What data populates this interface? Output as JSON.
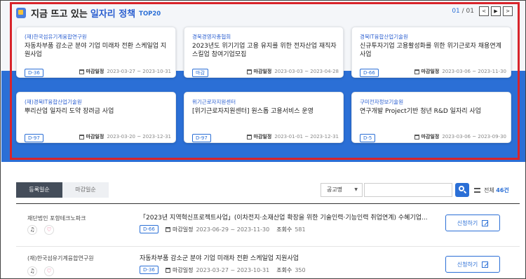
{
  "header": {
    "title_prefix": "지금 뜨고 있는",
    "title_main": "일자리 정책",
    "title_tag": "TOP20"
  },
  "pager": {
    "current": "01",
    "total": "/ 01",
    "prev": "<",
    "play": "▶",
    "next": ">"
  },
  "cards": [
    {
      "org": "(재)한국섬유기계융합연구원",
      "title": "자동차부품 감소군 분야 기업 미래차 전환 스케일업 지원사업",
      "badge": "D-36",
      "deadline_label": "마감일정",
      "period": "2023-03-27 ~ 2023-10-31"
    },
    {
      "org": "경북경영자총협회",
      "title": "2023년도 위기기업 고용 유지를 위한 전자산업 재직자 스킬업 참여기업모집",
      "badge": "마감",
      "deadline_label": "마감일정",
      "period": "2023-03-03 ~ 2023-04-28"
    },
    {
      "org": "경북IT융합산업기술원",
      "title": "신규투자기업 고용활성화를 위한 위기근로자 채용연계 사업",
      "badge": "D-66",
      "deadline_label": "마감일정",
      "period": "2023-03-06 ~ 2023-11-30"
    },
    {
      "org": "(재)경북IT융합산업기술원",
      "title": "뿌리산업 일자리 도약 장려금 사업",
      "badge": "D-97",
      "deadline_label": "마감일정",
      "period": "2023-03-20 ~ 2023-12-31"
    },
    {
      "org": "위기근로자지원센터",
      "title": "[위기근로자지원센터] 원스톱 고용서비스 운영",
      "badge": "D-97",
      "deadline_label": "마감일정",
      "period": "2023-01-01 ~ 2023-12-31"
    },
    {
      "org": "구미전자정보기술원",
      "title": "연구개발 Project기반 청년 R&D 일자리 사업",
      "badge": "D-5",
      "deadline_label": "마감일정",
      "period": "2023-03-06 ~ 2023-09-30"
    }
  ],
  "tabs": [
    {
      "label": "등록일순"
    },
    {
      "label": "마감일순"
    }
  ],
  "search": {
    "select_value": "공고명",
    "placeholder": ""
  },
  "total": {
    "label": "전체",
    "count": "46건"
  },
  "rows": [
    {
      "org": "재단법인 포항테크노파크",
      "title": "「2023년 지역혁신프로젝트사업」(이차전지·소재산업 확장을 위한 기술인력·기능인력 취업연계) 수혜기업...",
      "badge": "D-66",
      "deadline_label": "마감일정",
      "period": "2023-06-29 ~ 2023-11-30",
      "views_label": "조회수",
      "views": "581",
      "apply_label": "신청하기"
    },
    {
      "org": "(재)한국섬유기계융합연구원",
      "title": "자동차부품 감소군 분야 기업 미래차 전환 스케일업 지원사업",
      "badge": "D-36",
      "deadline_label": "마감일정",
      "period": "2023-03-27 ~ 2023-10-31",
      "views_label": "조회수",
      "views": "350",
      "apply_label": "신청하기"
    }
  ]
}
